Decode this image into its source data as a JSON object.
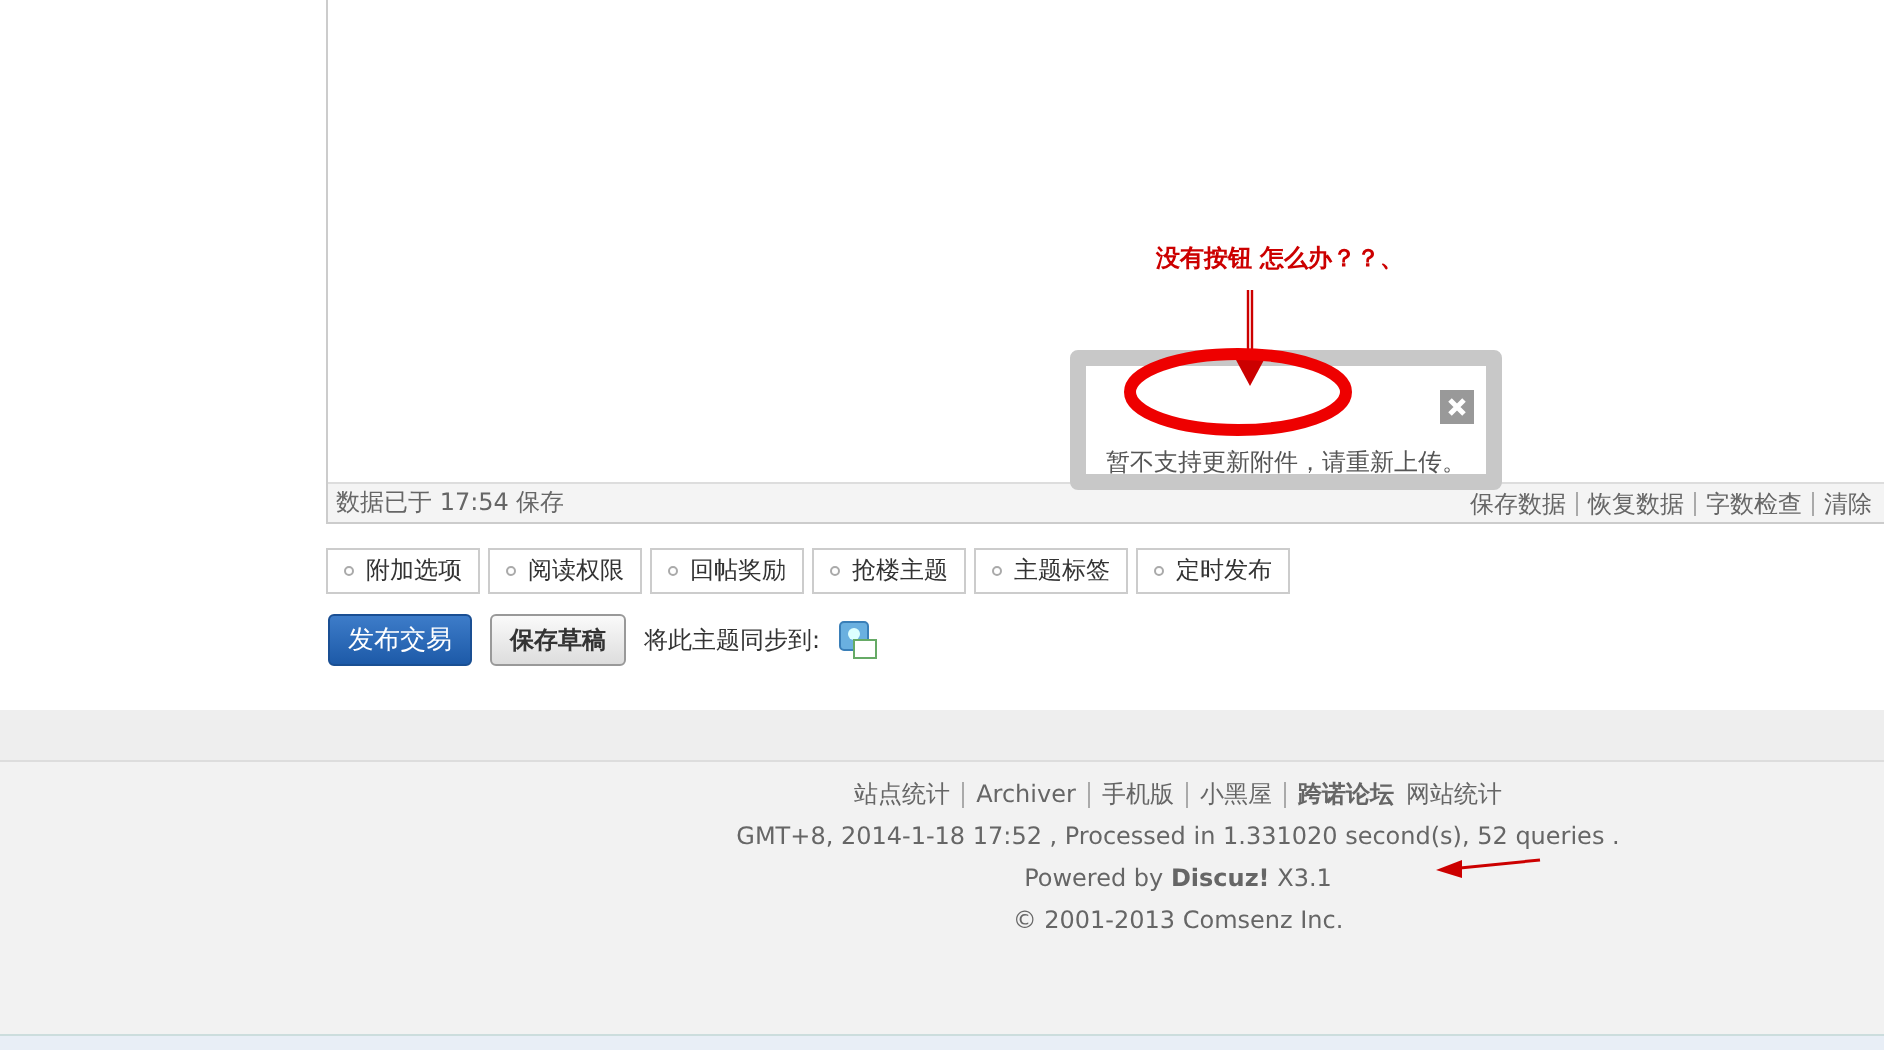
{
  "editor": {
    "status_text": "数据已于 17:54 保存",
    "status_links": [
      "保存数据",
      "恢复数据",
      "字数检查",
      "清除"
    ]
  },
  "dialog": {
    "message": "暂不支持更新附件，请重新上传。"
  },
  "annotation": {
    "text": "没有按钮 怎么办？？、"
  },
  "option_tabs": [
    "附加选项",
    "阅读权限",
    "回帖奖励",
    "抢楼主题",
    "主题标签",
    "定时发布"
  ],
  "actions": {
    "publish": "发布交易",
    "save_draft": "保存草稿",
    "sync_label": "将此主题同步到:"
  },
  "footer": {
    "links": [
      {
        "label": "站点统计",
        "bold": false
      },
      {
        "label": "Archiver",
        "bold": false
      },
      {
        "label": "手机版",
        "bold": false
      },
      {
        "label": "小黑屋",
        "bold": false
      },
      {
        "label": "跨诺论坛",
        "bold": true
      }
    ],
    "extra": "网站统计",
    "stats": "GMT+8, 2014-1-18 17:52 , Processed in 1.331020 second(s), 52 queries .",
    "powered": "Powered by **Discuz!** X3.1",
    "copyright": "© 2001-2013 Comsenz Inc."
  }
}
